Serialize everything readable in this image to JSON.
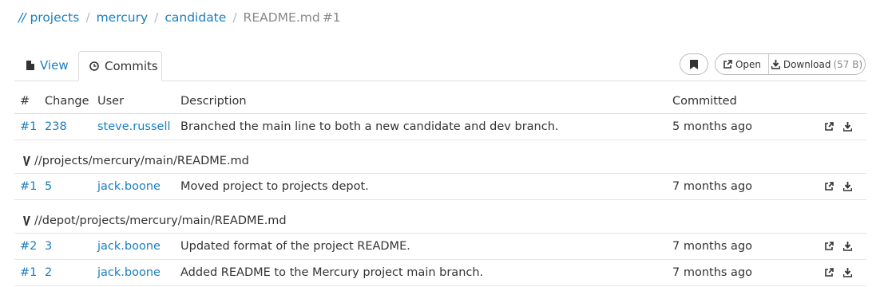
{
  "breadcrumb": {
    "root": "//",
    "items": [
      {
        "label": "projects"
      },
      {
        "label": "mercury"
      },
      {
        "label": "candidate"
      }
    ],
    "current": "README.md",
    "current_rev": "#1"
  },
  "tabs": {
    "view_label": "View",
    "commits_label": "Commits"
  },
  "toolbar": {
    "open_label": "Open",
    "download_label": "Download",
    "download_size": "(57 B)"
  },
  "table": {
    "headers": {
      "num": "#",
      "change": "Change",
      "user": "User",
      "description": "Description",
      "committed": "Committed"
    },
    "groups": [
      {
        "path": "",
        "rows": [
          {
            "num": "#1",
            "change": "238",
            "user": "steve.russell",
            "description": "Branched the main line to both a new candidate and dev branch.",
            "committed": "5 months ago"
          }
        ]
      },
      {
        "path": "//projects/mercury/main/README.md",
        "rows": [
          {
            "num": "#1",
            "change": "5",
            "user": "jack.boone",
            "description": "Moved project to projects depot.",
            "committed": "7 months ago"
          }
        ]
      },
      {
        "path": "//depot/projects/mercury/main/README.md",
        "rows": [
          {
            "num": "#2",
            "change": "3",
            "user": "jack.boone",
            "description": "Updated format of the project README.",
            "committed": "7 months ago"
          },
          {
            "num": "#1",
            "change": "2",
            "user": "jack.boone",
            "description": "Added README to the Mercury project main branch.",
            "committed": "7 months ago"
          }
        ]
      }
    ]
  }
}
